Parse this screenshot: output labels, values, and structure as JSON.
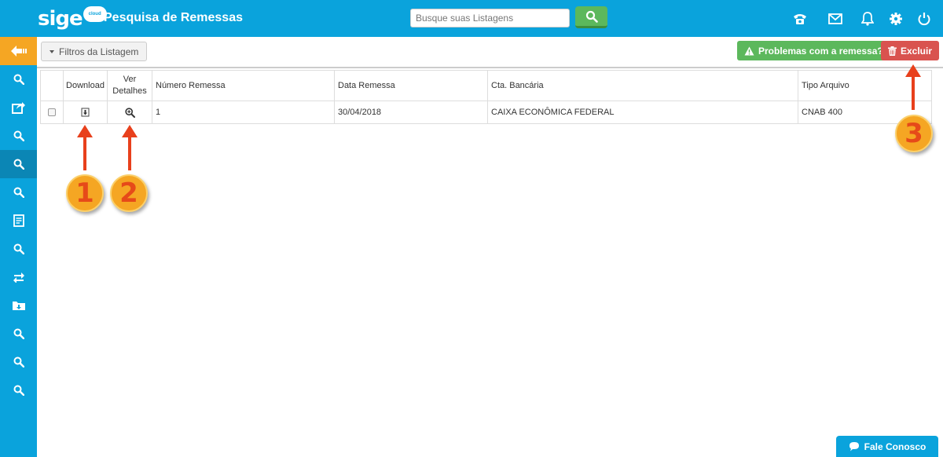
{
  "header": {
    "logo_text": "sige",
    "logo_badge": "cloud",
    "title": "Pesquisa de Remessas",
    "search_placeholder": "Busque suas Listagens",
    "icons": [
      "phone-icon",
      "mail-icon",
      "bell-icon",
      "gear-icon",
      "power-icon"
    ]
  },
  "sidebar": {
    "items": [
      "back-arrow-icon",
      "search-icon",
      "share-icon",
      "search-icon",
      "search-icon",
      "search-icon",
      "report-icon",
      "search-icon",
      "sync-icon",
      "folder-download-icon",
      "search-icon",
      "search-icon",
      "search-icon"
    ]
  },
  "toolbar": {
    "filter_label": "Filtros da Listagem",
    "problem_label": "Problemas com a remessa?",
    "delete_label": "Excluir"
  },
  "table": {
    "headers": {
      "download": "Download",
      "details_line1": "Ver",
      "details_line2": "Detalhes",
      "number": "Número Remessa",
      "date": "Data Remessa",
      "account": "Cta. Bancária",
      "file_type": "Tipo Arquivo"
    },
    "rows": [
      {
        "number": "1",
        "date": "30/04/2018",
        "account": "CAIXA ECONÔMICA FEDERAL",
        "file_type": "CNAB 400"
      }
    ]
  },
  "annotations": {
    "one": "1",
    "two": "2",
    "three": "3"
  },
  "chat": {
    "label": "Fale Conosco"
  },
  "colors": {
    "primary": "#0aa3dc",
    "accent": "#f5a623",
    "success": "#5cb85c",
    "danger": "#d9534f"
  }
}
